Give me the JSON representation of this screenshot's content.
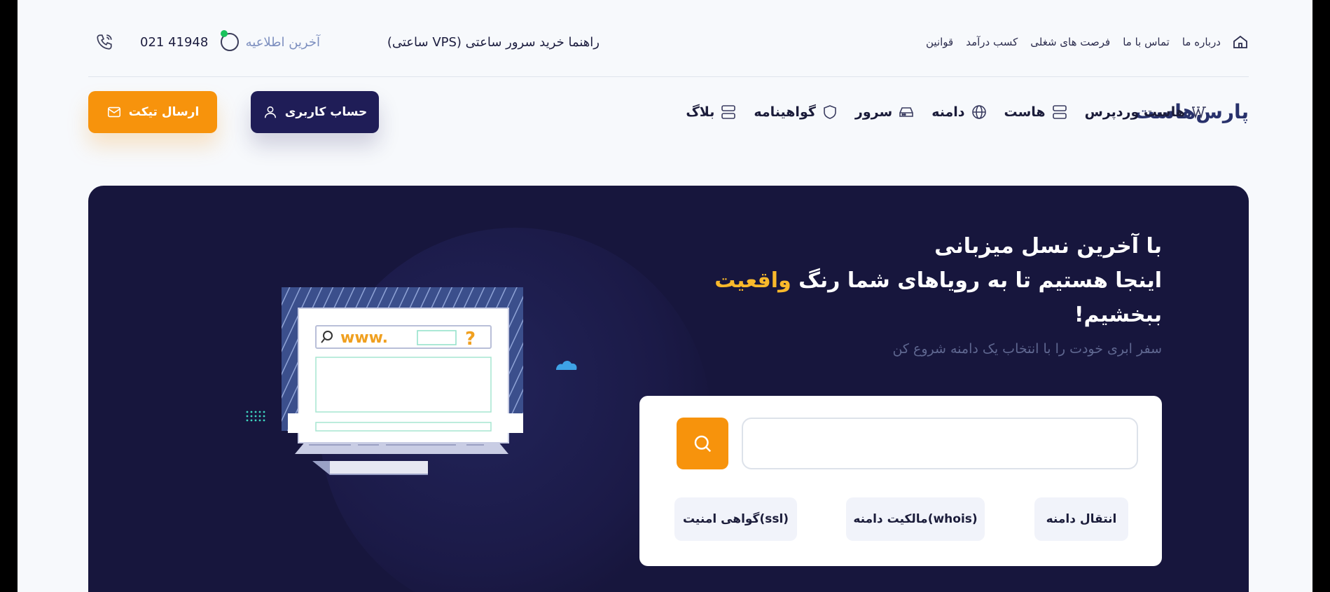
{
  "topbar": {
    "links": [
      "درباره ما",
      "تماس با ما",
      "فرصت های شغلی",
      "کسب درآمد",
      "قوانین"
    ],
    "guide": "راهنما خرید سرور ساعتی (VPS ساعتی)",
    "news": "آخرین اطلاعیه",
    "phone": "021 41948"
  },
  "logo": {
    "text": "پارس‌هاست"
  },
  "nav": {
    "items": [
      "هاست وردپرس",
      "هاست",
      "دامنه",
      "سرور",
      "گواهینامه",
      "بلاگ"
    ],
    "account": "حساب کاربری",
    "ticket": "ارسال تیکت"
  },
  "hero": {
    "line1": "با آخرین نسل میزبانی",
    "line2a": "اینجا هستیم تا به رویاهای شما رنگ",
    "line2b": "واقعیت",
    "line3": "ببخشیم!",
    "subtitle": "سفر ابری خودت را با انتخاب یک دامنه شروع کن",
    "search_placeholder": "",
    "chips": [
      "انتقال دامنه",
      "مالکیت دامنه(whois)",
      "گواهی امنیت(ssl)"
    ],
    "illustration_text": "www."
  },
  "colors": {
    "primary": "#1f1d57",
    "accent": "#f7930c",
    "hero_bg": "#17163d",
    "highlight": "#f9b92b",
    "online_dot": "#19c25b"
  }
}
